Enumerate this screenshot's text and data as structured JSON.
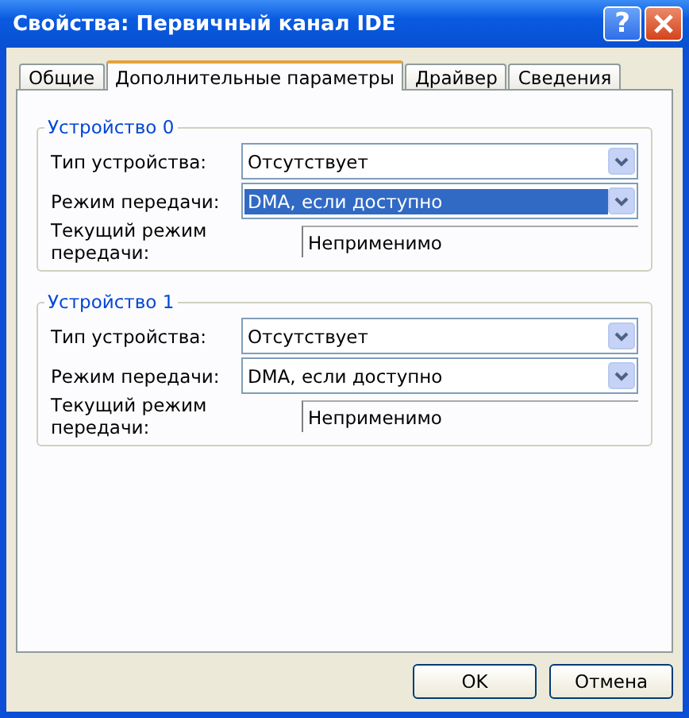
{
  "window": {
    "title": "Свойства: Первичный канал IDE",
    "help_button": "?"
  },
  "tabs": [
    {
      "label": "Общие",
      "selected": false
    },
    {
      "label": "Дополнительные параметры",
      "selected": true
    },
    {
      "label": "Драйвер",
      "selected": false
    },
    {
      "label": "Сведения",
      "selected": false
    }
  ],
  "devices": [
    {
      "title": "Устройство 0",
      "fields": [
        {
          "kind": "dropdown",
          "label": "Тип устройства:",
          "value": "Отсутствует",
          "selected": false
        },
        {
          "kind": "dropdown",
          "label": "Режим передачи:",
          "value": "DMA, если доступно",
          "selected": true
        },
        {
          "kind": "readonly",
          "label": "Текущий режим передачи:",
          "value": "Неприменимо"
        }
      ]
    },
    {
      "title": "Устройство 1",
      "fields": [
        {
          "kind": "dropdown",
          "label": "Тип устройства:",
          "value": "Отсутствует",
          "selected": false
        },
        {
          "kind": "dropdown",
          "label": "Режим передачи:",
          "value": "DMA, если доступно",
          "selected": false
        },
        {
          "kind": "readonly",
          "label": "Текущий режим передачи:",
          "value": "Неприменимо"
        }
      ]
    }
  ],
  "buttons": [
    "OK",
    "Отмена"
  ]
}
